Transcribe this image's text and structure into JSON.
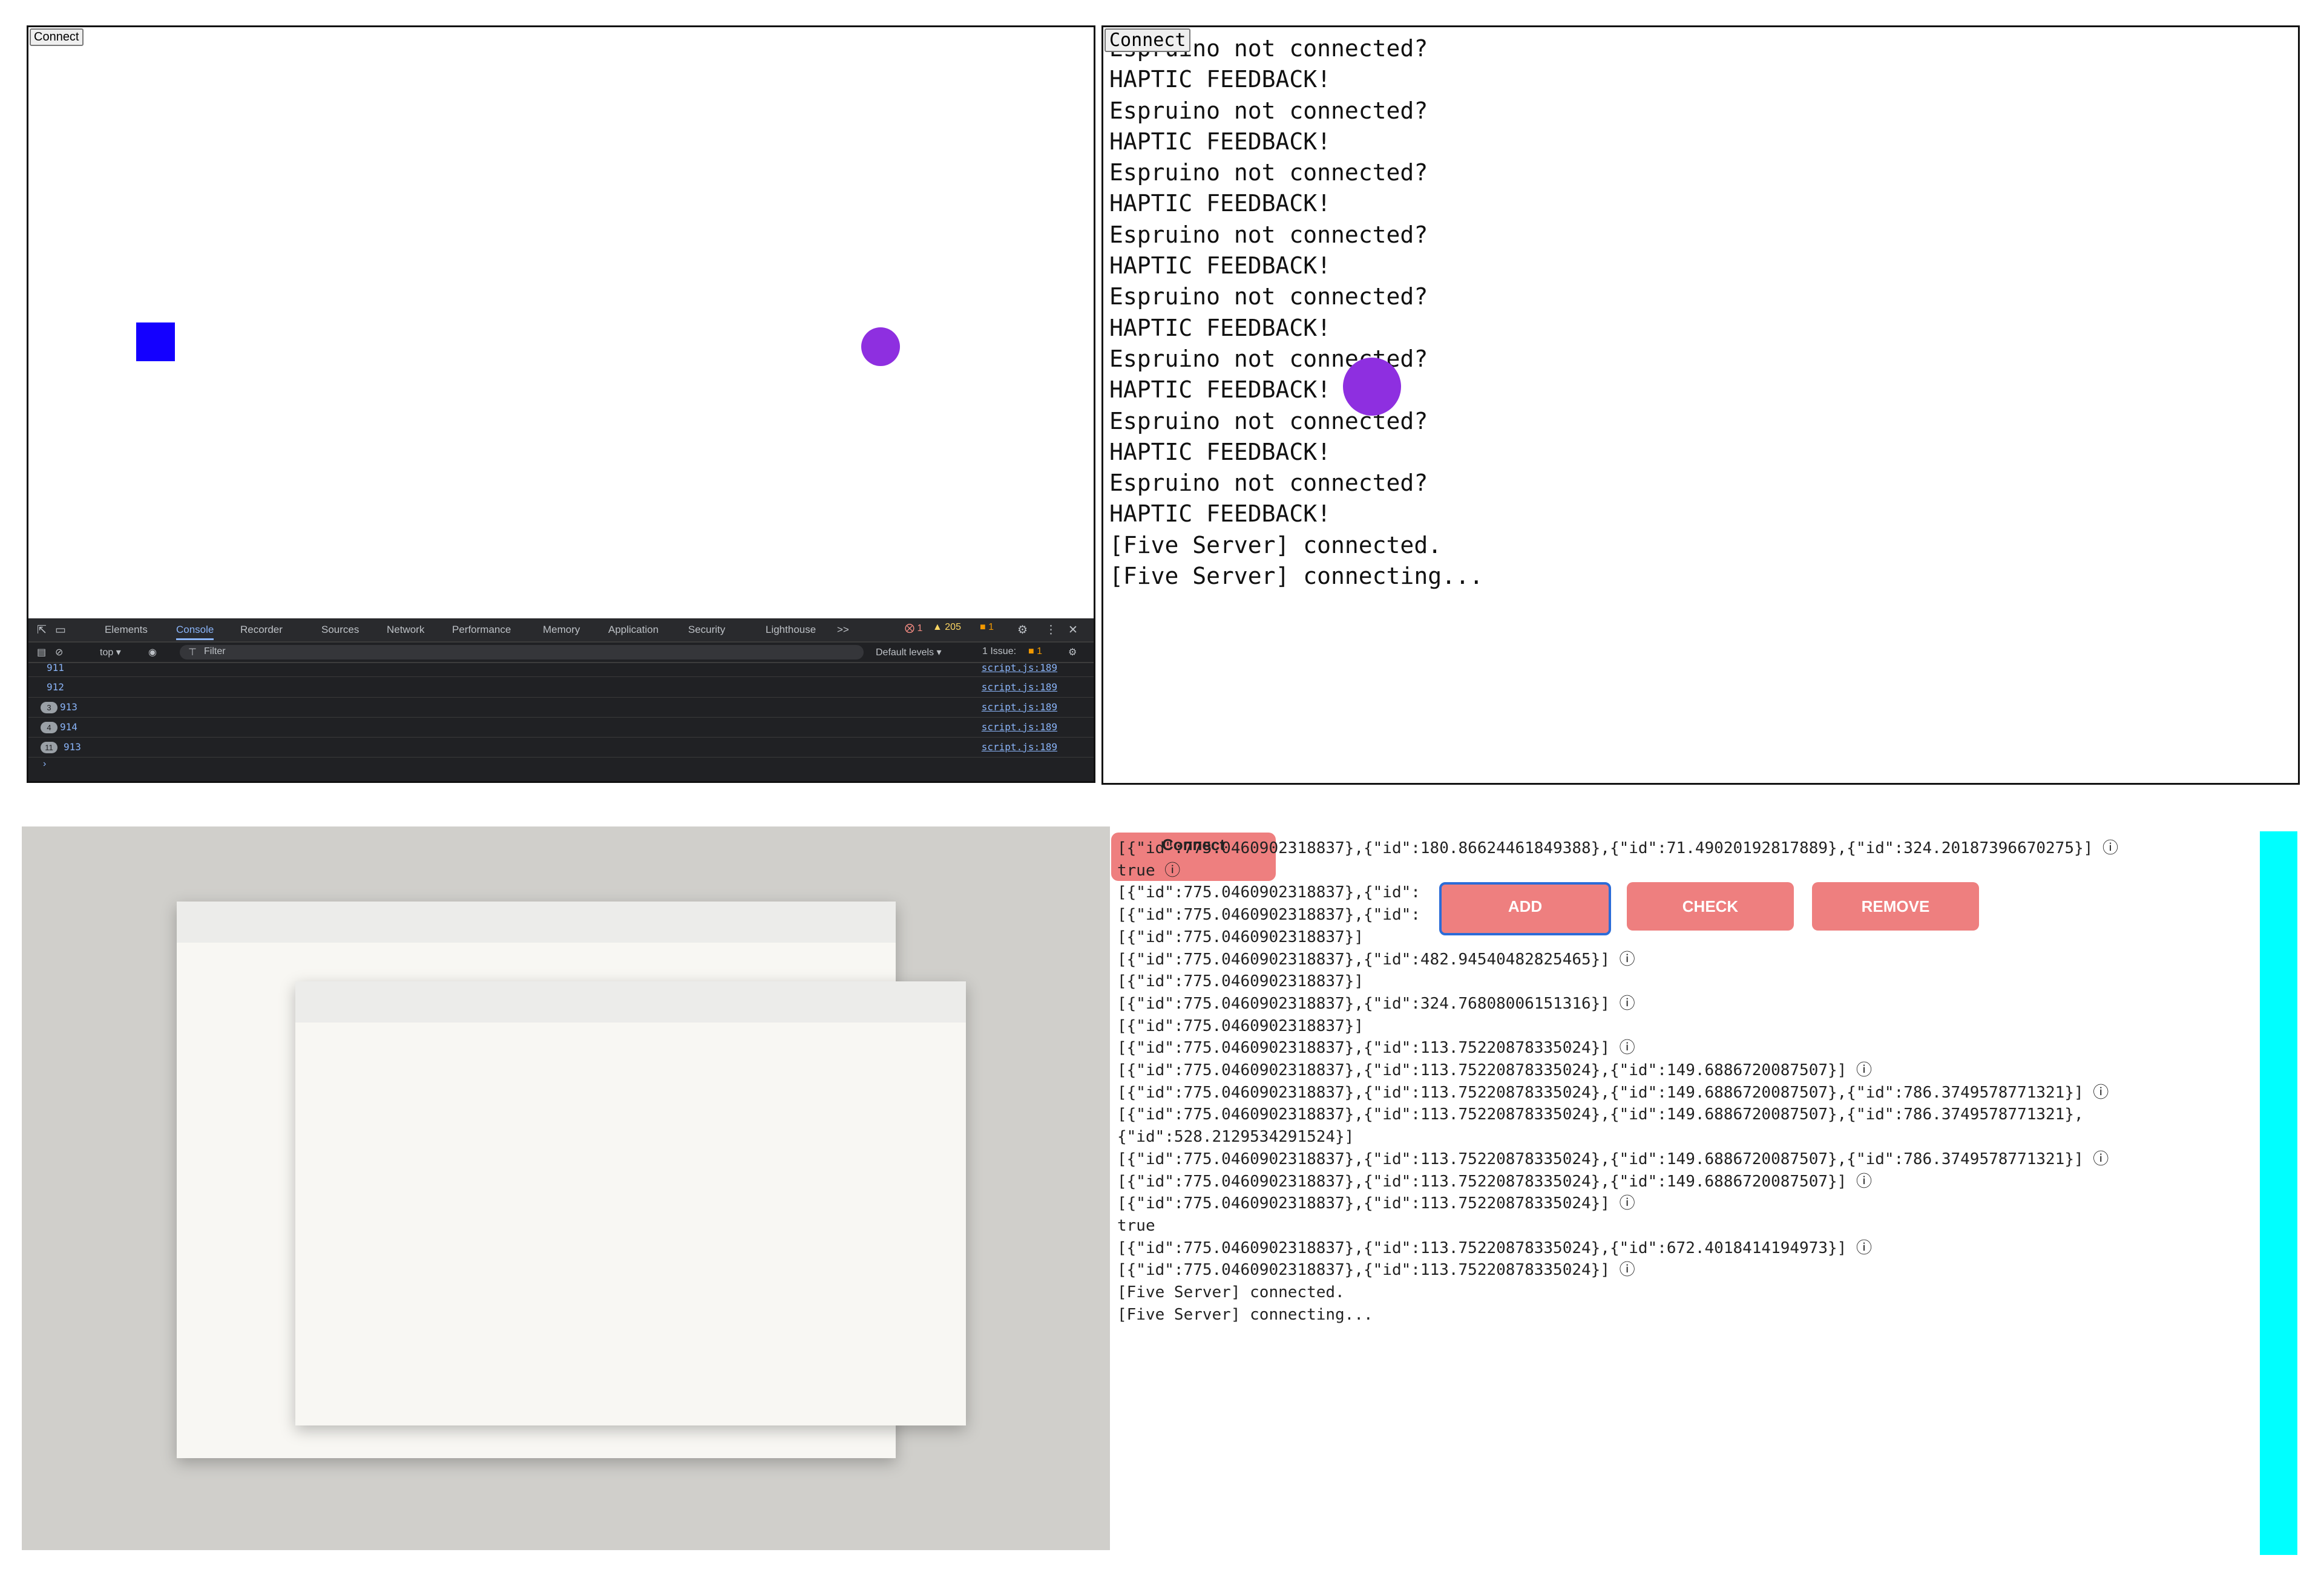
{
  "panel1": {
    "connect_label": "Connect",
    "devtools": {
      "tabs": [
        "Elements",
        "Console",
        "Recorder",
        "Sources",
        "Network",
        "Performance",
        "Memory",
        "Application",
        "Security",
        "Lighthouse"
      ],
      "active_tab": "Console",
      "more": ">>",
      "errors": "1",
      "warnings": "205",
      "issues_count": "1",
      "context": "top ▾",
      "filter_placeholder": "Filter",
      "default_levels": "Default levels ▾",
      "issue_label": "1 Issue:",
      "issue_num": "1",
      "rows": [
        {
          "badge": "",
          "num": "911",
          "src": "script.js:189"
        },
        {
          "badge": "",
          "num": "912",
          "src": "script.js:189"
        },
        {
          "badge": "3",
          "num": "913",
          "src": "script.js:189"
        },
        {
          "badge": "4",
          "num": "914",
          "src": "script.js:189"
        },
        {
          "badge": "11",
          "num": "913",
          "src": "script.js:189"
        }
      ]
    }
  },
  "panel2": {
    "connect_label": "Connect",
    "log_lines": [
      "Espruino not connected?",
      "HAPTIC FEEDBACK!",
      "Espruino not connected?",
      "HAPTIC FEEDBACK!",
      "Espruino not connected?",
      "HAPTIC FEEDBACK!",
      "Espruino not connected?",
      "HAPTIC FEEDBACK!",
      "Espruino not connected?",
      "HAPTIC FEEDBACK!",
      "Espruino not connected?",
      "HAPTIC FEEDBACK!",
      "Espruino not connected?",
      "HAPTIC FEEDBACK!",
      "Espruino not connected?",
      "HAPTIC FEEDBACK!",
      "[Five Server] connected.",
      "[Five Server] connecting..."
    ]
  },
  "panel4": {
    "connect_label": "Connect",
    "buttons": {
      "add": "ADD",
      "check": "CHECK",
      "remove": "REMOVE"
    },
    "log_lines": [
      "[{\"id\":775.0460902318837},{\"id\":180.86624461849388},{\"id\":71.49020192817889},{\"id\":324.20187396670275}] ⓘ",
      "true ⓘ",
      "[{\"id\":775.0460902318837},{\"id\":                8}            92",
      "[{\"id\":775.0460902318837},{\"id\":                8}",
      "[{\"id\":775.0460902318837}]",
      "[{\"id\":775.0460902318837},{\"id\":482.94540482825465}] ⓘ",
      "[{\"id\":775.0460902318837}]",
      "[{\"id\":775.0460902318837},{\"id\":324.76808006151316}] ⓘ",
      "[{\"id\":775.0460902318837}]",
      "[{\"id\":775.0460902318837},{\"id\":113.75220878335024}] ⓘ",
      "[{\"id\":775.0460902318837},{\"id\":113.75220878335024},{\"id\":149.6886720087507}] ⓘ",
      "[{\"id\":775.0460902318837},{\"id\":113.75220878335024},{\"id\":149.6886720087507},{\"id\":786.3749578771321}] ⓘ",
      "[{\"id\":775.0460902318837},{\"id\":113.75220878335024},{\"id\":149.6886720087507},{\"id\":786.3749578771321},",
      "{\"id\":528.2129534291524}]",
      "[{\"id\":775.0460902318837},{\"id\":113.75220878335024},{\"id\":149.6886720087507},{\"id\":786.3749578771321}] ⓘ",
      "[{\"id\":775.0460902318837},{\"id\":113.75220878335024},{\"id\":149.6886720087507}] ⓘ",
      "[{\"id\":775.0460902318837},{\"id\":113.75220878335024}] ⓘ",
      "true",
      "[{\"id\":775.0460902318837},{\"id\":113.75220878335024},{\"id\":672.4018414194973}] ⓘ",
      "[{\"id\":775.0460902318837},{\"id\":113.75220878335024}] ⓘ",
      "[Five Server] connected.",
      "[Five Server] connecting..."
    ]
  },
  "colors": {
    "square": "#1400ff",
    "dot": "#8e2fe0",
    "button": "#ee7f7f",
    "cyan_bar": "#00ffff",
    "desktop": "#d0cfcb"
  }
}
